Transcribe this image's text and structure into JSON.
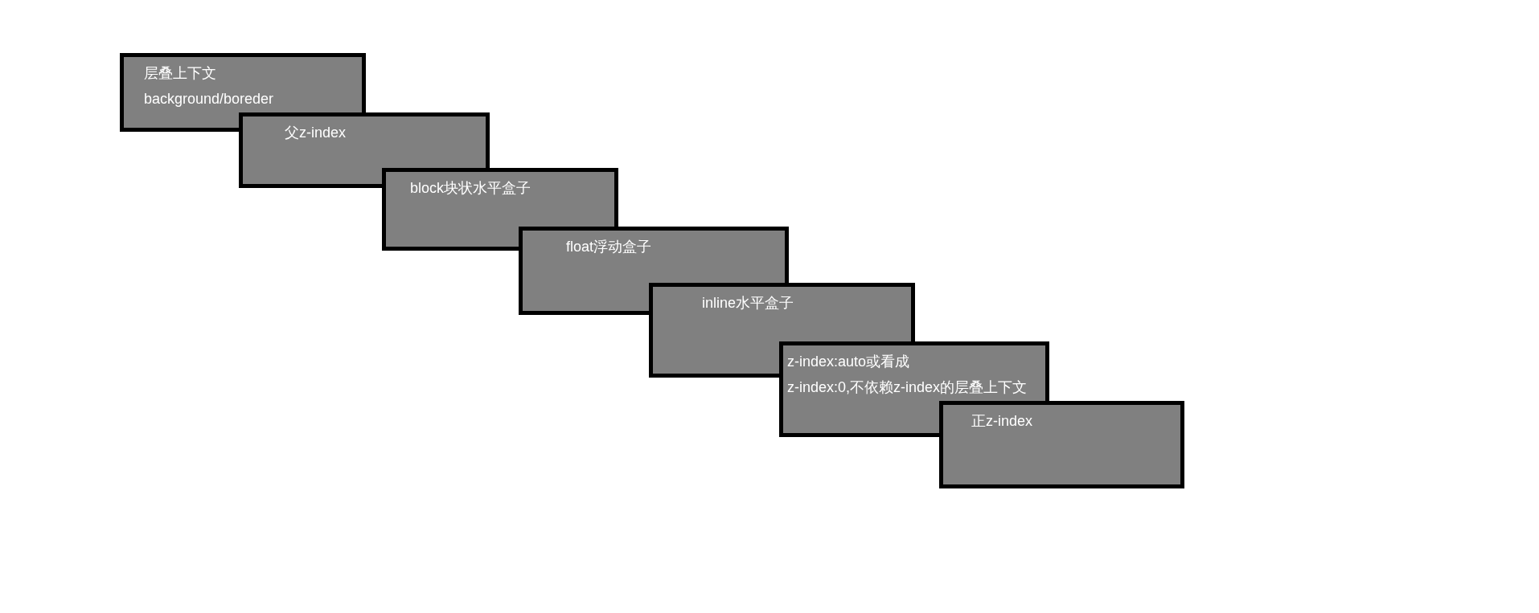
{
  "boxes": [
    {
      "lines": [
        "层叠上下文",
        "background/boreder"
      ]
    },
    {
      "lines": [
        "父z-index"
      ]
    },
    {
      "lines": [
        "block块状水平盒子"
      ]
    },
    {
      "lines": [
        "float浮动盒子"
      ]
    },
    {
      "lines": [
        "inline水平盒子"
      ]
    },
    {
      "lines": [
        "z-index:auto或看成",
        "z-index:0,不依赖z-index的层叠上下文"
      ]
    },
    {
      "lines": [
        "正z-index"
      ]
    }
  ]
}
